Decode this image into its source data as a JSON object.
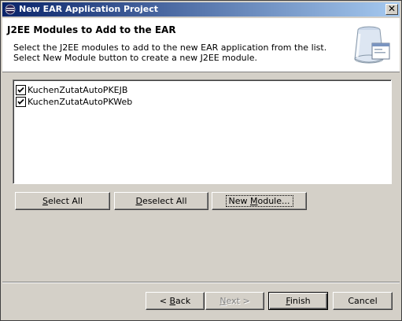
{
  "window": {
    "title": "New EAR Application Project",
    "close_glyph": "✕"
  },
  "banner": {
    "title": "J2EE Modules to Add to the EAR",
    "description_line1": "Select the J2EE modules to add to the new EAR application from the list.",
    "description_line2": "Select New Module button to create a new J2EE module.",
    "icon": "ear-project-wizard-icon"
  },
  "modules": [
    {
      "label": "KuchenZutatAutoPKEJB",
      "checked": true
    },
    {
      "label": "KuchenZutatAutoPKWeb",
      "checked": true
    }
  ],
  "actions": {
    "select_all": {
      "pre": "",
      "mn": "S",
      "post": "elect All"
    },
    "deselect_all": {
      "pre": "",
      "mn": "D",
      "post": "eselect All"
    },
    "new_module": {
      "pre": "New ",
      "mn": "M",
      "post": "odule..."
    }
  },
  "footer": {
    "back": {
      "pre": "< ",
      "mn": "B",
      "post": "ack"
    },
    "next": {
      "pre": "",
      "mn": "N",
      "post": "ext >"
    },
    "finish": {
      "pre": "",
      "mn": "F",
      "post": "inish"
    },
    "cancel": "Cancel"
  },
  "colors": {
    "titlebar_start": "#0a246a",
    "titlebar_end": "#a6caf0",
    "dialog_bg": "#d4d0c8"
  }
}
